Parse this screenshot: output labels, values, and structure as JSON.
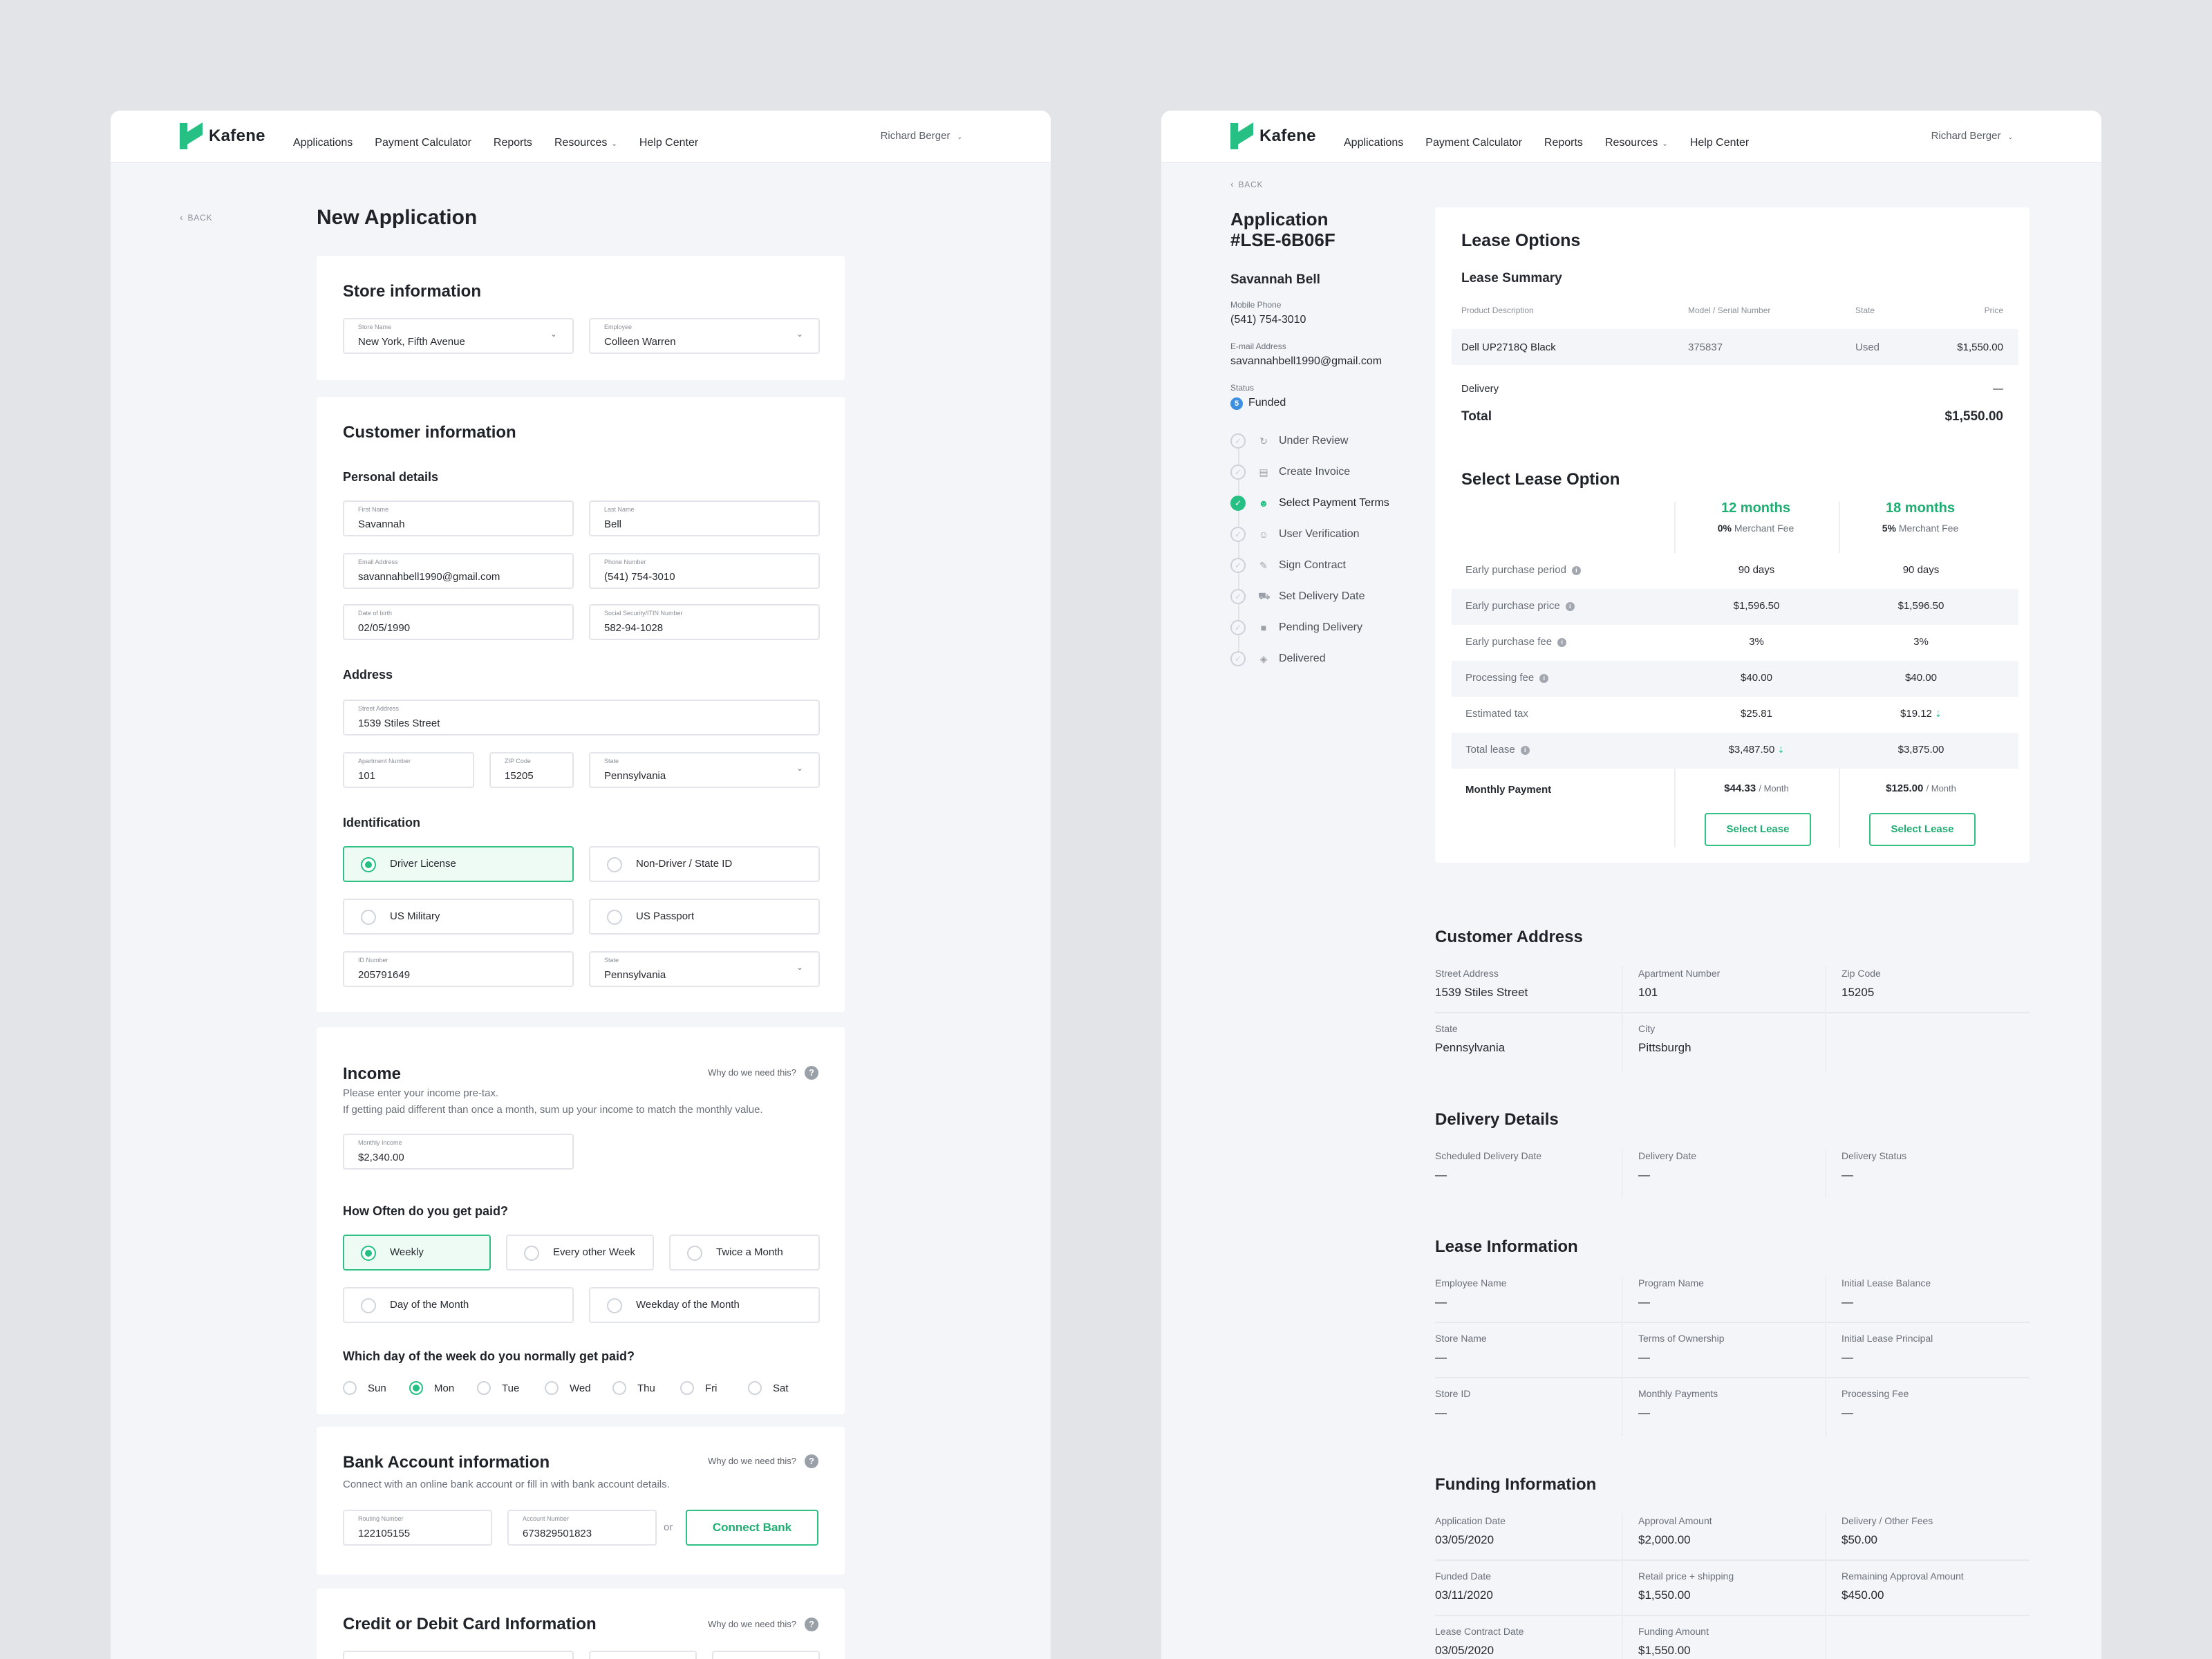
{
  "nav": {
    "brand": "Kafene",
    "items": [
      "Applications",
      "Payment Calculator",
      "Reports",
      "Resources",
      "Help Center"
    ],
    "user": "Richard Berger"
  },
  "left": {
    "back": "BACK",
    "title": "New Application",
    "store": {
      "title": "Store information",
      "store_name_label": "Store Name",
      "store_name": "New York, Fifth Avenue",
      "employee_label": "Employee",
      "employee": "Colleen Warren"
    },
    "customer": {
      "title": "Customer information",
      "personal": "Personal details",
      "first_name_label": "First Name",
      "first_name": "Savannah",
      "last_name_label": "Last Name",
      "last_name": "Bell",
      "email_label": "Email Address",
      "email": "savannahbell1990@gmail.com",
      "phone_label": "Phone Number",
      "phone": "(541) 754-3010",
      "dob_label": "Date of birth",
      "dob": "02/05/1990",
      "ssn_label": "Social Security/ITIN Number",
      "ssn": "582-94-1028",
      "address": "Address",
      "street_label": "Street Address",
      "street": "1539 Stiles Street",
      "apt_label": "Apartment Number",
      "apt": "101",
      "zip_label": "ZIP Code",
      "zip": "15205",
      "state_label": "State",
      "state": "Pennsylvania",
      "identification": "Identification",
      "id_options": [
        "Driver License",
        "Non-Driver / State ID",
        "US Military",
        "US Passport"
      ],
      "id_number_label": "ID Number",
      "id_number": "205791649",
      "id_state_label": "State",
      "id_state": "Pennsylvania"
    },
    "income": {
      "title": "Income",
      "why": "Why do we need this?",
      "help1": "Please enter your income pre-tax.",
      "help2": "If getting paid different than once a month, sum up your income to match the monthly value.",
      "monthly_label": "Monthly Income",
      "monthly": "$2,340.00",
      "freq_title": "How Often do you get paid?",
      "freq": [
        "Weekly",
        "Every other Week",
        "Twice a Month",
        "Day of the Month",
        "Weekday of the Month"
      ],
      "day_title": "Which day of the week do you normally get paid?",
      "days": [
        "Sun",
        "Mon",
        "Tue",
        "Wed",
        "Thu",
        "Fri",
        "Sat"
      ]
    },
    "bank": {
      "title": "Bank Account information",
      "why": "Why do we need this?",
      "help": "Connect with an online bank account or fill in with bank account details.",
      "routing_label": "Routing Number",
      "routing": "122105155",
      "account_label": "Account Number",
      "account": "673829501823",
      "or": "or",
      "connect": "Connect Bank"
    },
    "card": {
      "title": "Credit or Debit Card Information",
      "why": "Why do we need this?"
    }
  },
  "right": {
    "back": "BACK",
    "app_title_1": "Application",
    "app_title_2": "#LSE-6B06F",
    "customer_name": "Savannah Bell",
    "phone_label": "Mobile Phone",
    "phone": "(541) 754-3010",
    "email_label": "E-mail Address",
    "email": "savannahbell1990@gmail.com",
    "status_label": "Status",
    "status_num": "5",
    "status": "Funded",
    "steps": [
      "Under Review",
      "Create Invoice",
      "Select Payment Terms",
      "User Verification",
      "Sign Contract",
      "Set Delivery Date",
      "Pending  Delivery",
      "Delivered"
    ],
    "lease": {
      "title": "Lease Options",
      "summary": "Lease Summary",
      "cols": [
        "Product Description",
        "Model / Serial Number",
        "State",
        "Price"
      ],
      "product": "Dell UP2718Q Black",
      "serial": "375837",
      "state": "Used",
      "price": "$1,550.00",
      "delivery_label": "Delivery",
      "delivery": "—",
      "total_label": "Total",
      "total": "$1,550.00",
      "select_title": "Select Lease Option",
      "opt1": "12 months",
      "opt1_fee": "0%",
      "opt2": "18 months",
      "opt2_fee": "5%",
      "fee_word": "Merchant Fee",
      "rows": [
        {
          "label": "Early purchase period",
          "a": "90 days",
          "b": "90 days"
        },
        {
          "label": "Early purchase price",
          "a": "$1,596.50",
          "b": "$1,596.50"
        },
        {
          "label": "Early purchase fee",
          "a": "3%",
          "b": "3%"
        },
        {
          "label": "Processing fee",
          "a": "$40.00",
          "b": "$40.00"
        },
        {
          "label": "Estimated tax",
          "a": "$25.81",
          "b": "$19.12"
        },
        {
          "label": "Total lease",
          "a": "$3,487.50",
          "b": "$3,875.00"
        }
      ],
      "monthly_label": "Monthly Payment",
      "monthly_a": "$44.33",
      "monthly_b": "$125.00",
      "per_month": "/ Month",
      "select_btn": "Select Lease"
    },
    "address": {
      "title": "Customer Address",
      "cells": [
        {
          "l": "Street Address",
          "v": "1539 Stiles Street"
        },
        {
          "l": "Apartment Number",
          "v": "101"
        },
        {
          "l": "Zip Code",
          "v": "15205"
        },
        {
          "l": "State",
          "v": "Pennsylvania"
        },
        {
          "l": "City",
          "v": "Pittsburgh"
        }
      ]
    },
    "delivery": {
      "title": "Delivery Details",
      "cells": [
        {
          "l": "Scheduled Delivery Date",
          "v": "—"
        },
        {
          "l": "Delivery Date",
          "v": "—"
        },
        {
          "l": "Delivery Status",
          "v": "—"
        }
      ]
    },
    "leaseinfo": {
      "title": "Lease Information",
      "cells": [
        {
          "l": "Employee Name",
          "v": "—"
        },
        {
          "l": "Program Name",
          "v": "—"
        },
        {
          "l": "Initial Lease Balance",
          "v": "—"
        },
        {
          "l": "Store Name",
          "v": "—"
        },
        {
          "l": "Terms of Ownership",
          "v": "—"
        },
        {
          "l": "Initial Lease Principal",
          "v": "—"
        },
        {
          "l": "Store ID",
          "v": "—"
        },
        {
          "l": "Monthly Payments",
          "v": "—"
        },
        {
          "l": "Processing Fee",
          "v": "—"
        }
      ]
    },
    "funding": {
      "title": "Funding Information",
      "cells": [
        {
          "l": "Application Date",
          "v": "03/05/2020"
        },
        {
          "l": "Approval Amount",
          "v": "$2,000.00"
        },
        {
          "l": "Delivery / Other Fees",
          "v": "$50.00"
        },
        {
          "l": "Funded Date",
          "v": "03/11/2020"
        },
        {
          "l": "Retail price + shipping",
          "v": "$1,550.00"
        },
        {
          "l": "Remaining Approval Amount",
          "v": "$450.00"
        },
        {
          "l": "Lease Contract Date",
          "v": "03/05/2020"
        },
        {
          "l": "Funding Amount",
          "v": "$1,550.00"
        }
      ]
    }
  },
  "colors": {
    "accent": "#27c084",
    "background": "#e3e4e8",
    "status_blue": "#3d8fe0"
  }
}
